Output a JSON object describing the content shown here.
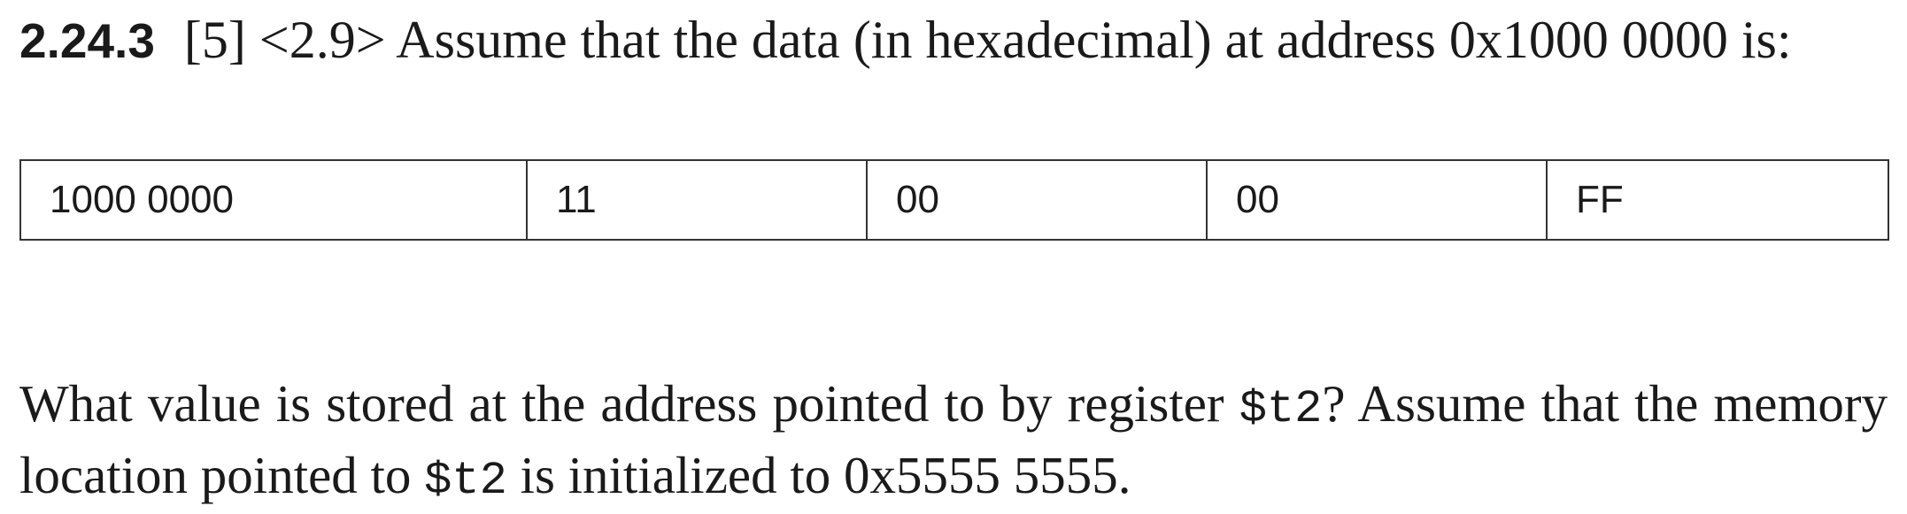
{
  "exercise": {
    "number": "2.24.3",
    "points": "[5]",
    "section_ref": "<2.9>",
    "intro": "Assume that the data (in hexadecimal) at address 0x1000 0000 is:"
  },
  "memory_table": {
    "cells": [
      "1000 0000",
      "11",
      "00",
      "00",
      "FF"
    ]
  },
  "question": {
    "part1": "What value is stored at the address pointed to by register ",
    "reg1": "$t2",
    "part2": "? Assume that the memory location pointed to ",
    "reg2": "$t2",
    "part3": " is initialized to 0x5555 5555."
  }
}
